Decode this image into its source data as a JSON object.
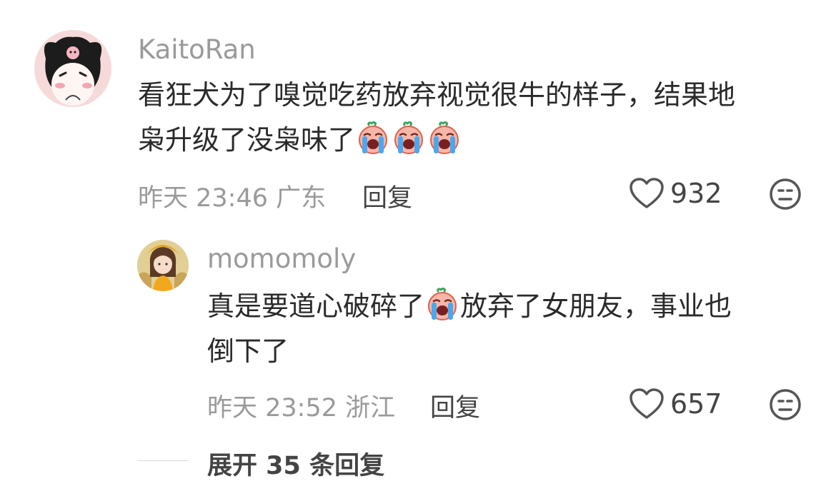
{
  "comments": [
    {
      "username": "KaitoRan",
      "content_line1": "看狂犬为了嗅觉吃药放弃视觉很牛的样子，结果地",
      "content_line2": "枭升级了没枭味了",
      "emoji": "crying-face-emoji",
      "time": "昨天 23:46",
      "location": "广东",
      "reply_label": "回复",
      "likes": "932",
      "avatar": "kuromi-avatar"
    },
    {
      "username": "momomoly",
      "content_part1": "真是要道心破碎了",
      "content_part2": "放弃了女朋友，事业也",
      "content_line2": "倒下了",
      "emoji": "crying-face-emoji",
      "time": "昨天 23:52",
      "location": "浙江",
      "reply_label": "回复",
      "likes": "657",
      "avatar": "anime-girl-avatar"
    }
  ],
  "expand_replies": "展开 35 条回复",
  "colors": {
    "meta": "#9a9a9a",
    "text": "#2a2a2a",
    "emoji_face": "#f7b6a8",
    "emoji_tears": "#4aa8f0"
  }
}
